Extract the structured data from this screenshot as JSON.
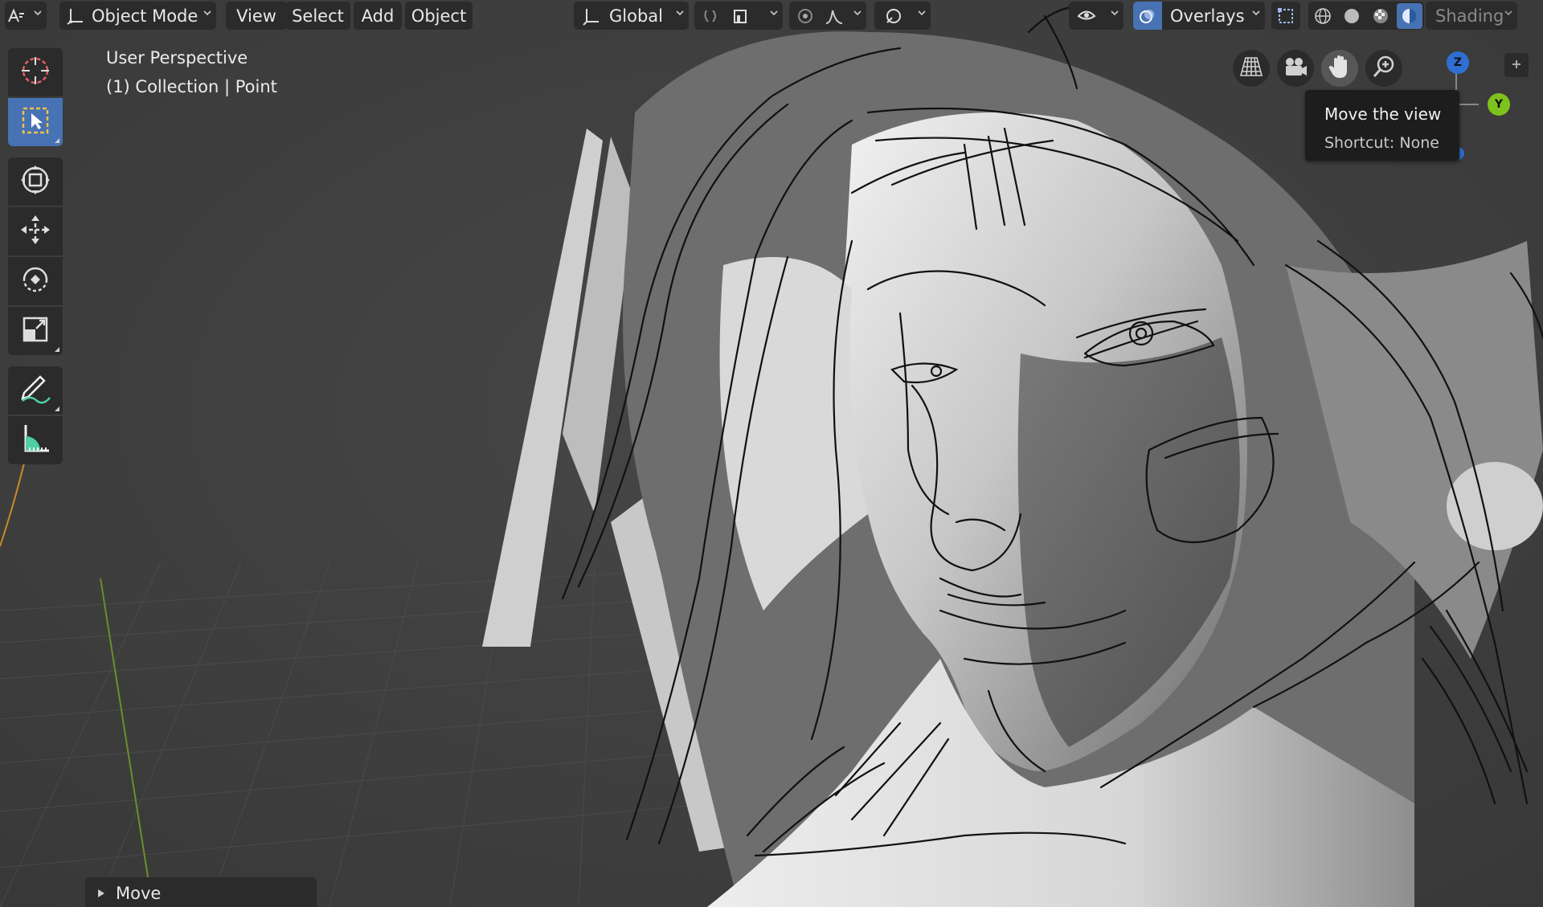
{
  "header": {
    "editor_type_icon": "viewport-editor-icon",
    "mode": {
      "label": "Object Mode",
      "icon": "object-mode-icon"
    },
    "menus": [
      "View",
      "Select",
      "Add",
      "Object"
    ],
    "transform_orientation": {
      "label": "Global",
      "icon": "orientation-axes-icon"
    },
    "pivot_icon": "pivot-point-icon",
    "snap_icon": "snap-magnet-icon",
    "proportional_icon": "proportional-editing-icon",
    "falloff_icon": "falloff-curve-icon",
    "gizmo_toggle_icon": "gizmo-eye-icon",
    "overlays": {
      "label": "Overlays",
      "icon": "overlays-icon"
    },
    "xray_icon": "xray-toggle-icon",
    "shading_modes": [
      "wireframe-shading-icon",
      "solid-shading-icon",
      "material-preview-icon",
      "rendered-shading-icon"
    ],
    "shading_label": "Shading"
  },
  "toolbar": {
    "tools": [
      {
        "name": "cursor",
        "icon": "cursor-tool-icon",
        "active": false
      },
      {
        "name": "select-box",
        "icon": "select-box-icon",
        "active": true
      },
      {
        "name": "transform",
        "icon": "transform-tool-icon",
        "active": false
      },
      {
        "name": "move",
        "icon": "move-tool-icon",
        "active": false
      },
      {
        "name": "rotate",
        "icon": "rotate-tool-icon",
        "active": false
      },
      {
        "name": "scale",
        "icon": "scale-tool-icon",
        "active": false
      },
      {
        "name": "annotate",
        "icon": "annotate-tool-icon",
        "active": false
      },
      {
        "name": "measure",
        "icon": "measure-tool-icon",
        "active": false
      }
    ]
  },
  "viewport": {
    "view_name": "User Perspective",
    "collection_info": "(1) Collection | Point"
  },
  "navigation": {
    "buttons": [
      "toggle-perspective-icon",
      "camera-view-icon",
      "move-view-hand-icon",
      "zoom-view-icon"
    ],
    "tooltip": {
      "title": "Move the view",
      "shortcut": "Shortcut: None"
    }
  },
  "gizmo": {
    "z_label": "Z",
    "y_label": "Y",
    "colors": {
      "z": "#2f6fd1",
      "y": "#7ec21c",
      "x": "#d4394c"
    }
  },
  "last_operator": {
    "label": "Move"
  },
  "colors": {
    "header_button": "#2b2b2b",
    "accent": "#4772b3",
    "viewport_bg": "#404040",
    "tooltip_bg": "#1d1d1d"
  }
}
